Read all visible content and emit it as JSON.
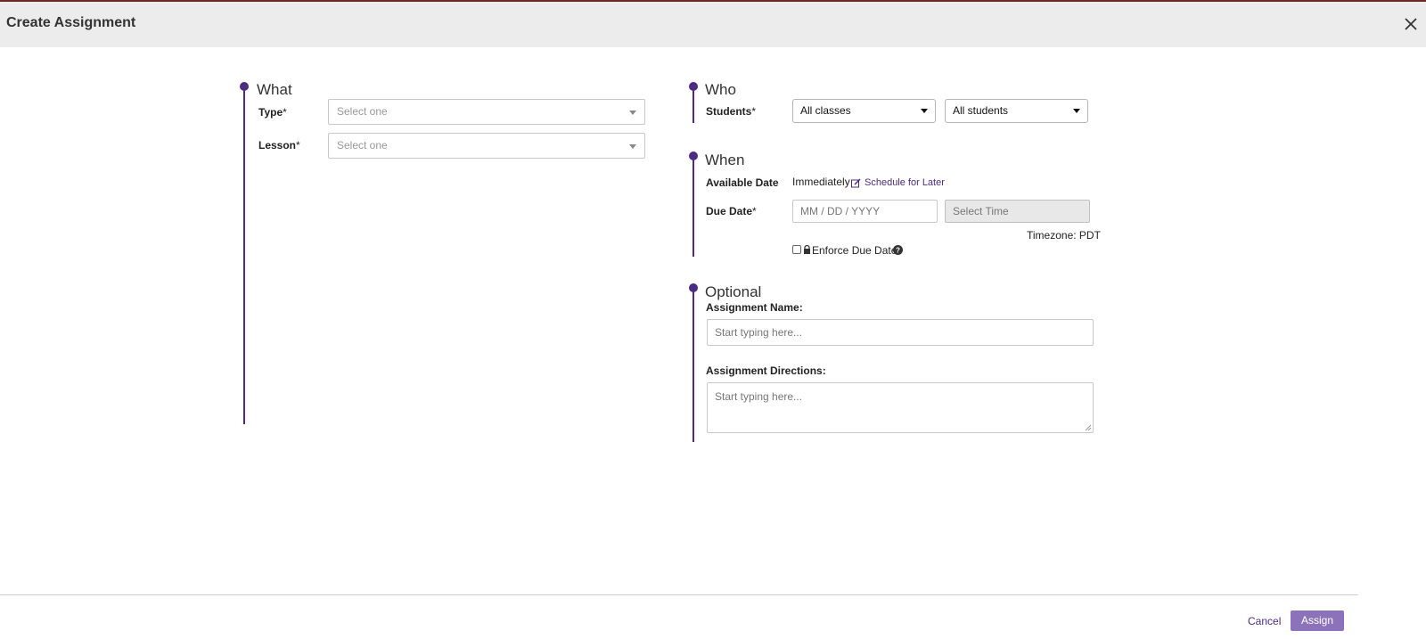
{
  "header": {
    "title": "Create Assignment",
    "close_icon": "close-icon"
  },
  "what": {
    "title": "What",
    "type": {
      "label": "Type",
      "required": "*",
      "placeholder": "Select one"
    },
    "lesson": {
      "label": "Lesson",
      "required": "*",
      "placeholder": "Select one"
    }
  },
  "who": {
    "title": "Who",
    "students": {
      "label": "Students",
      "required": "*",
      "classes_value": "All classes",
      "students_value": "All students"
    }
  },
  "when": {
    "title": "When",
    "available": {
      "label": "Available Date",
      "value": "Immediately",
      "schedule_link": "Schedule for Later",
      "edit_icon": "edit-icon"
    },
    "due": {
      "label": "Due Date",
      "required": "*",
      "date_placeholder": "MM / DD / YYYY",
      "time_placeholder": "Select Time"
    },
    "timezone": "Timezone: PDT",
    "enforce": {
      "label": "Enforce Due Date",
      "lock_icon": "lock-icon",
      "help_icon": "help-icon"
    }
  },
  "optional": {
    "title": "Optional",
    "name": {
      "label": "Assignment Name:",
      "placeholder": "Start typing here..."
    },
    "directions": {
      "label": "Assignment Directions:",
      "placeholder": "Start typing here..."
    }
  },
  "footer": {
    "cancel": "Cancel",
    "assign": "Assign"
  },
  "colors": {
    "accent": "#4b2c82",
    "assign_button": "#8c72b8",
    "header_bg": "#ececec"
  }
}
